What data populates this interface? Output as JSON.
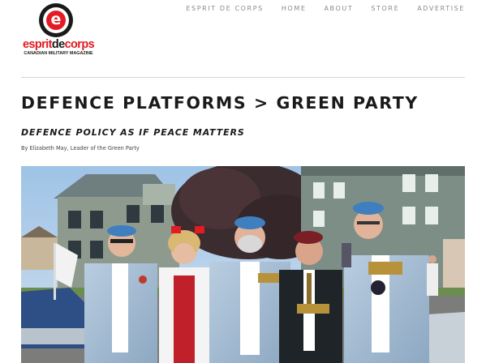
{
  "brand": {
    "logo_letter": "e",
    "name_part1": "esprit",
    "name_part2": "de",
    "name_part3": "corps",
    "tagline": "CANADIAN MILITARY MAGAZINE",
    "colors": {
      "red": "#e31b23",
      "dark": "#1a1a1a"
    }
  },
  "nav": {
    "items": [
      "ESPRIT DE CORPS",
      "HOME",
      "ABOUT",
      "STORE",
      "ADVERTISE"
    ]
  },
  "page": {
    "title": "DEFENCE PLATFORMS > GREEN PARTY",
    "subtitle": "DEFENCE POLICY AS IF PEACE MATTERS",
    "byline": "By Elizabeth May, Leader of the Green Party"
  }
}
